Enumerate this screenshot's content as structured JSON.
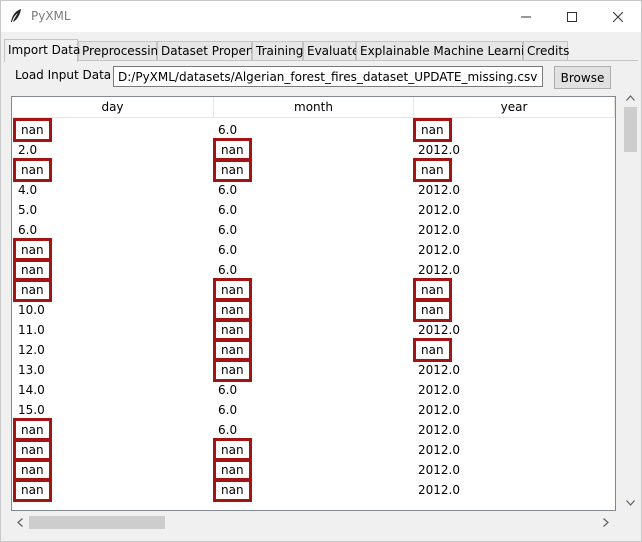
{
  "window": {
    "title": "PyXML"
  },
  "tabs": [
    {
      "label": "Import Data",
      "active": true
    },
    {
      "label": "Preprocessing",
      "active": false
    },
    {
      "label": "Dataset Property",
      "active": false
    },
    {
      "label": "Training",
      "active": false
    },
    {
      "label": "Evaluate",
      "active": false
    },
    {
      "label": "Explainable Machine Learning",
      "active": false
    },
    {
      "label": "Credits",
      "active": false
    }
  ],
  "load": {
    "label": "Load Input Data",
    "path": "D:/PyXML/datasets/Algerian_forest_fires_dataset_UPDATE_missing.csv",
    "browse_label": "Browse"
  },
  "table": {
    "columns": [
      "day",
      "month",
      "year"
    ],
    "rows": [
      [
        "nan",
        "6.0",
        "nan"
      ],
      [
        "2.0",
        "nan",
        "2012.0"
      ],
      [
        "nan",
        "nan",
        "nan"
      ],
      [
        "4.0",
        "6.0",
        "2012.0"
      ],
      [
        "5.0",
        "6.0",
        "2012.0"
      ],
      [
        "6.0",
        "6.0",
        "2012.0"
      ],
      [
        "nan",
        "6.0",
        "2012.0"
      ],
      [
        "nan",
        "6.0",
        "2012.0"
      ],
      [
        "nan",
        "nan",
        "nan"
      ],
      [
        "10.0",
        "nan",
        "nan"
      ],
      [
        "11.0",
        "nan",
        "2012.0"
      ],
      [
        "12.0",
        "nan",
        "nan"
      ],
      [
        "13.0",
        "nan",
        "2012.0"
      ],
      [
        "14.0",
        "6.0",
        "2012.0"
      ],
      [
        "15.0",
        "6.0",
        "2012.0"
      ],
      [
        "nan",
        "6.0",
        "2012.0"
      ],
      [
        "nan",
        "nan",
        "2012.0"
      ],
      [
        "nan",
        "nan",
        "2012.0"
      ],
      [
        "nan",
        "nan",
        "2012.0"
      ]
    ],
    "highlight_color": "#a31515"
  },
  "icons": {
    "app": "feather-icon",
    "minimize": "minimize-icon",
    "maximize": "maximize-icon",
    "close": "close-icon"
  }
}
